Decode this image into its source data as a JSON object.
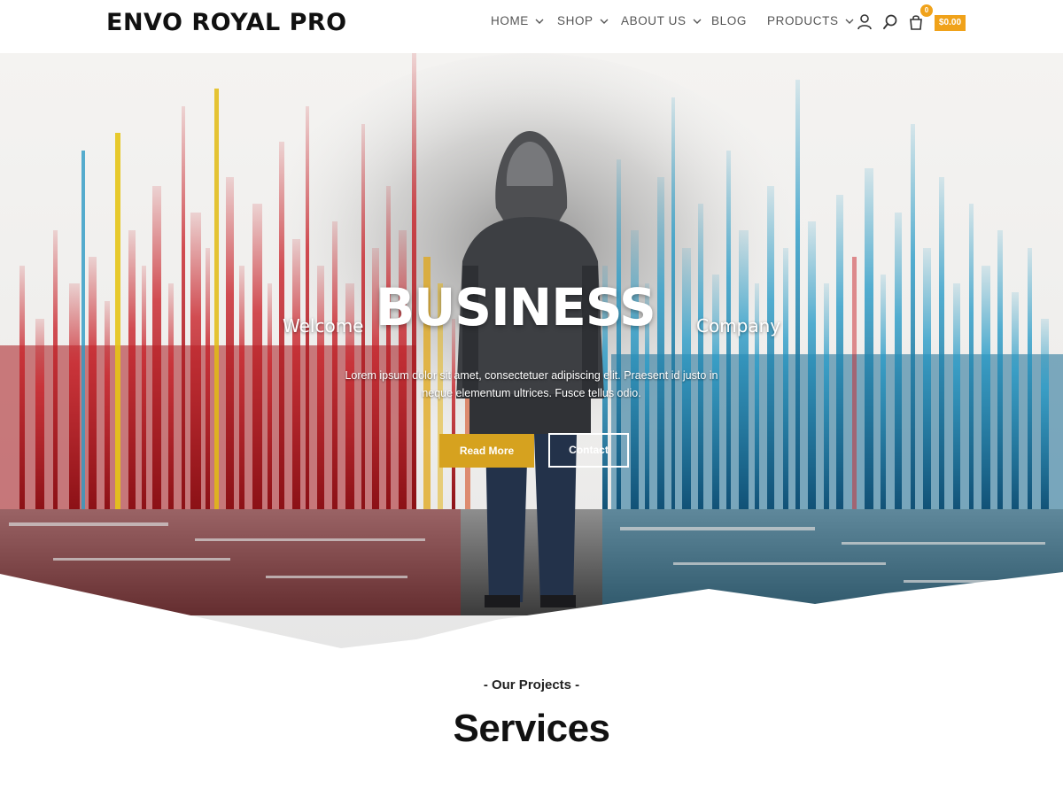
{
  "header": {
    "logo": "ENVO ROYAL PRO",
    "nav": [
      {
        "label": "HOME",
        "has_dropdown": true
      },
      {
        "label": "SHOP",
        "has_dropdown": true
      },
      {
        "label": "ABOUT US",
        "has_dropdown": true
      },
      {
        "label": "BLOG",
        "has_dropdown": false
      },
      {
        "label": "PRODUCTS",
        "has_dropdown": true
      }
    ],
    "icons": [
      "user-icon",
      "search-icon",
      "cart-icon"
    ],
    "cart_count": "0",
    "cart_total": "$0.00",
    "accent_color": "#f0a21a"
  },
  "hero": {
    "welcome": "Welcome",
    "headline": "BUSINESS",
    "company": "Company",
    "description_line1": "Lorem ipsum dolor sit amet, consectetuer adipiscing elit. Praesent id justo in",
    "description_line2": "neque elementum ultrices. Fusce tellus odio.",
    "read_more_label": "Read More",
    "contact_label": "Contact",
    "button_color": "#d6a21f"
  },
  "section": {
    "subtitle": "- Our Projects -",
    "title": "Services"
  }
}
